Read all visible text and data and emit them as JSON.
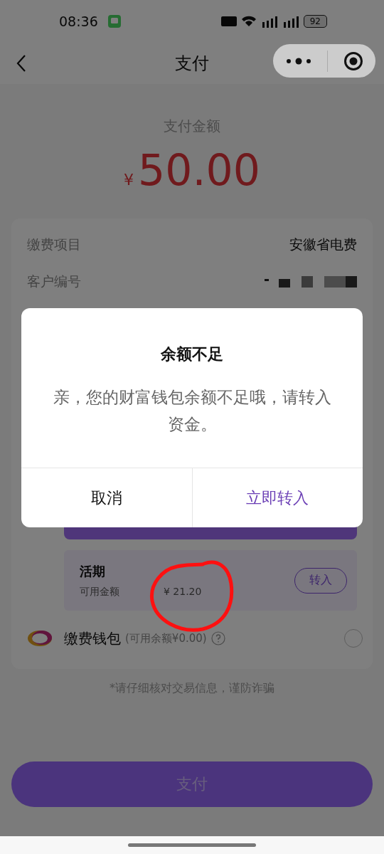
{
  "status_bar": {
    "time": "08:36",
    "battery": "92"
  },
  "nav": {
    "title": "支付"
  },
  "amount": {
    "label": "支付金额",
    "currency": "¥",
    "value": "50.00"
  },
  "details": [
    {
      "kind": "text",
      "label": "缴费项目",
      "value": "安徽省电费"
    },
    {
      "kind": "masked",
      "label": "客户编号"
    }
  ],
  "wallet": {
    "title": "活期",
    "available_label": "可用金额",
    "available_amount": "¥ 21.20",
    "transfer_button": "转入"
  },
  "payment_options": [
    {
      "name": "缴费钱包",
      "note": "(可用余额¥0.00)",
      "selected": false
    }
  ],
  "notice": "*请仔细核对交易信息，谨防诈骗",
  "pay_button": "支付",
  "dialog": {
    "title": "余额不足",
    "message": "亲，您的财富钱包余额不足哦，请转入资金。",
    "buttons": [
      {
        "kind": "cancel",
        "label": "取消"
      },
      {
        "kind": "confirm",
        "label": "立即转入"
      }
    ]
  }
}
